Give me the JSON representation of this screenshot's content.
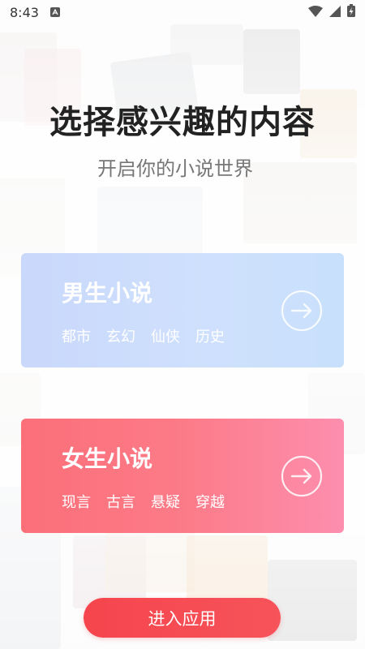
{
  "status_bar": {
    "time": "8:43",
    "notification_icon": "a-letter-icon",
    "wifi_icon": "wifi-icon",
    "signal_icon": "signal-icon",
    "battery_icon": "battery-charging-icon"
  },
  "header": {
    "title": "选择感兴趣的内容",
    "subtitle": "开启你的小说世界"
  },
  "categories": [
    {
      "title": "男生小说",
      "tags": [
        "都市",
        "玄幻",
        "仙侠",
        "历史"
      ],
      "arrow_icon": "arrow-right-circle-icon",
      "gradient": [
        "#c9d8fb",
        "#c8e0fb"
      ]
    },
    {
      "title": "女生小说",
      "tags": [
        "现言",
        "古言",
        "悬疑",
        "穿越"
      ],
      "arrow_icon": "arrow-right-circle-icon",
      "gradient": [
        "#fb6f79",
        "#fd8eae"
      ]
    }
  ],
  "enter_button": {
    "label": "进入应用",
    "color": "#f5454d"
  }
}
